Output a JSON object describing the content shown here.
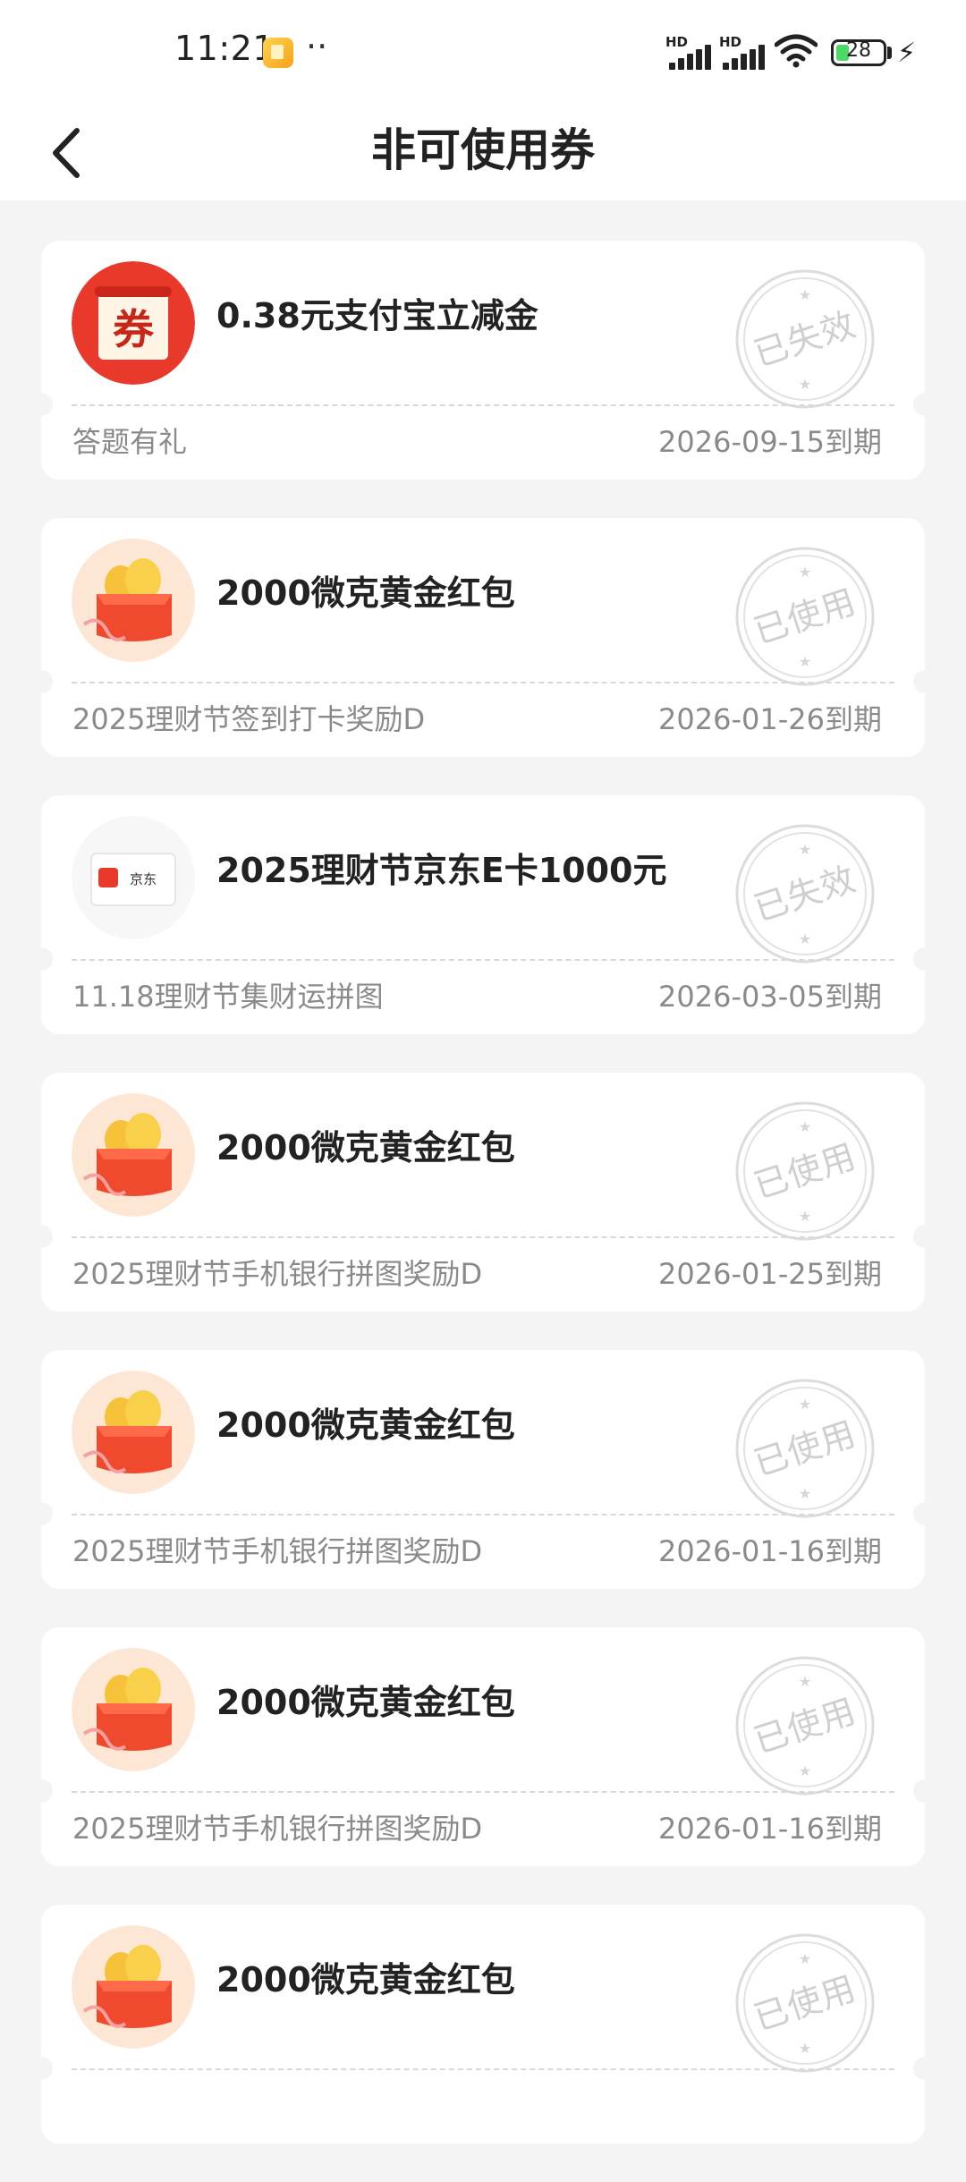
{
  "status_bar": {
    "time": "11:21",
    "dots": "··",
    "signal_1_label": "HD",
    "signal_2_label": "HD",
    "battery_level": "28"
  },
  "header": {
    "title": "非可使用券",
    "back_icon": "chevron-left-icon"
  },
  "colors": {
    "accent_red": "#e8392b",
    "stamp_gray": "#cfcfcf",
    "muted_text": "#8a8a8a"
  },
  "coupons": [
    {
      "title": "0.38元支付宝立减金",
      "subtitle": "答题有礼",
      "expiry": "2026-09-15到期",
      "stamp": "已失效",
      "icon": "coupon-ticket-icon",
      "icon_text": "券"
    },
    {
      "title": "2000微克黄金红包",
      "subtitle": "2025理财节签到打卡奖励D",
      "expiry": "2026-01-26到期",
      "stamp": "已使用",
      "icon": "gold-red-envelope-icon"
    },
    {
      "title": "2025理财节京东E卡1000元",
      "subtitle": "11.18理财节集财运拼图",
      "expiry": "2026-03-05到期",
      "stamp": "已失效",
      "icon": "jd-card-icon",
      "icon_text": "京东"
    },
    {
      "title": "2000微克黄金红包",
      "subtitle": "2025理财节手机银行拼图奖励D",
      "expiry": "2026-01-25到期",
      "stamp": "已使用",
      "icon": "gold-red-envelope-icon"
    },
    {
      "title": "2000微克黄金红包",
      "subtitle": "2025理财节手机银行拼图奖励D",
      "expiry": "2026-01-16到期",
      "stamp": "已使用",
      "icon": "gold-red-envelope-icon"
    },
    {
      "title": "2000微克黄金红包",
      "subtitle": "2025理财节手机银行拼图奖励D",
      "expiry": "2026-01-16到期",
      "stamp": "已使用",
      "icon": "gold-red-envelope-icon"
    },
    {
      "title": "2000微克黄金红包",
      "subtitle": "",
      "expiry": "",
      "stamp": "已使用",
      "icon": "gold-red-envelope-icon"
    }
  ]
}
